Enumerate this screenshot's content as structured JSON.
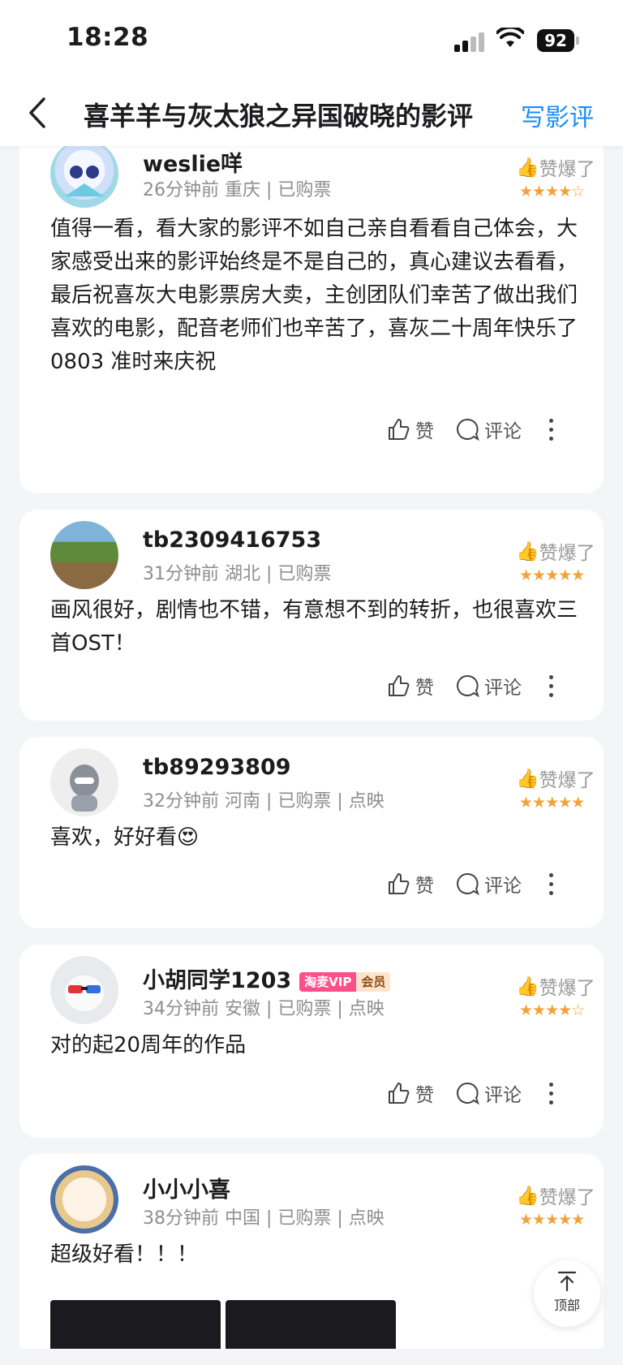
{
  "status": {
    "time": "18:28",
    "battery": "92"
  },
  "nav": {
    "title": "喜羊羊与灰太狼之异国破晓的影评",
    "write_review": "写影评"
  },
  "reviews": [
    {
      "username": "weslie咩",
      "meta": "26分钟前  重庆 | 已购票",
      "badge": "赞爆了",
      "stars": 4.5,
      "text": "值得一看，看大家的影评不如自己亲自看看自己体会，大家感受出来的影评始终是不是自己的，真心建议去看看，最后祝喜灰大电影票房大卖，主创团队们幸苦了做出我们喜欢的电影，配音老师们也辛苦了，喜灰二十周年快乐了 0803 准时来庆祝",
      "like": "赞",
      "comment": "评论"
    },
    {
      "username": "tb2309416753",
      "meta": "31分钟前  湖北 | 已购票",
      "badge": "赞爆了",
      "stars": 5,
      "text": "画风很好，剧情也不错，有意想不到的转折，也很喜欢三首OST！",
      "like": "赞",
      "comment": "评论"
    },
    {
      "username": "tb89293809",
      "meta": "32分钟前  河南 | 已购票 | 点映",
      "badge": "赞爆了",
      "stars": 5,
      "text": "喜欢，好好看😍",
      "like": "赞",
      "comment": "评论"
    },
    {
      "username": "小胡同学1203",
      "vip_a": "淘麦VIP",
      "vip_b": "会员",
      "meta": "34分钟前  安徽 | 已购票 | 点映",
      "badge": "赞爆了",
      "stars": 4.5,
      "text": "对的起20周年的作品",
      "like": "赞",
      "comment": "评论"
    },
    {
      "username": "小小小喜",
      "meta": "38分钟前  中国 | 已购票 | 点映",
      "badge": "赞爆了",
      "stars": 5,
      "text": "超级好看！！！"
    }
  ],
  "top_button": "顶部",
  "star_glyphs": {
    "full": "★★★★★",
    "half": "★★★★☆"
  },
  "colors": {
    "accent": "#1a8cff",
    "star": "#f2a23a"
  }
}
